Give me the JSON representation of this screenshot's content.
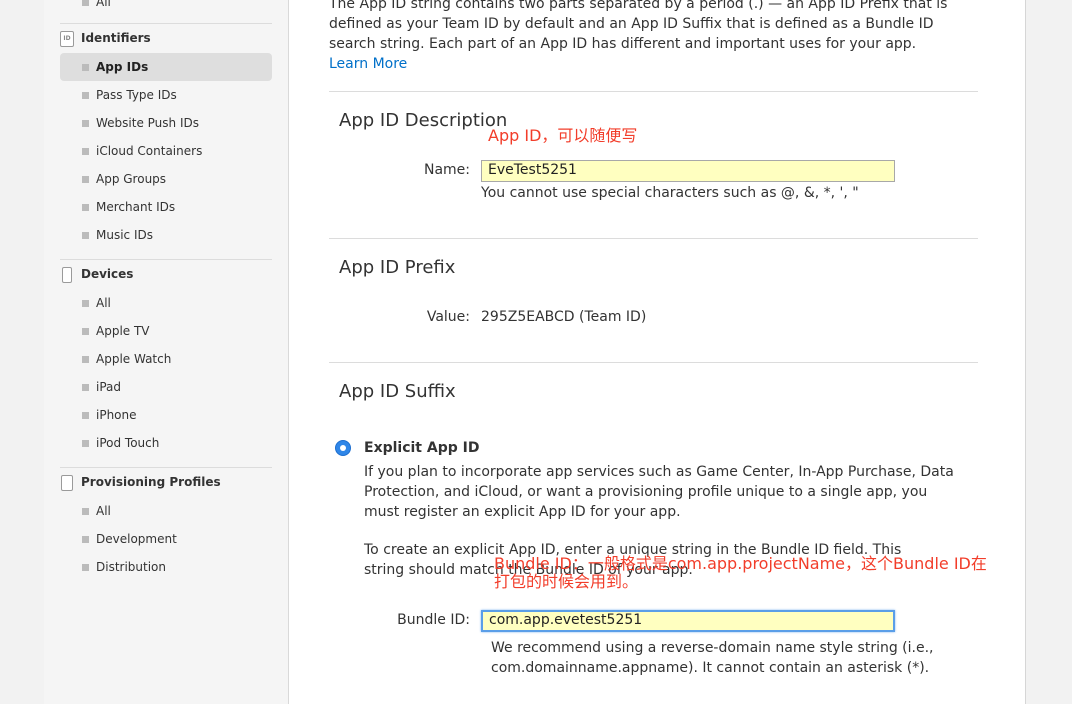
{
  "sidebar": {
    "top_item": "All",
    "identifiers": {
      "header": "Identifiers",
      "icon_text": "ID",
      "items": [
        "App IDs",
        "Pass Type IDs",
        "Website Push IDs",
        "iCloud Containers",
        "App Groups",
        "Merchant IDs",
        "Music IDs"
      ]
    },
    "devices": {
      "header": "Devices",
      "items": [
        "All",
        "Apple TV",
        "Apple Watch",
        "iPad",
        "iPhone",
        "iPod Touch"
      ]
    },
    "profiles": {
      "header": "Provisioning Profiles",
      "items": [
        "All",
        "Development",
        "Distribution"
      ]
    }
  },
  "intro": {
    "text": "The App ID string contains two parts separated by a period (.) — an App ID Prefix that is defined as your Team ID by default and an App ID Suffix that is defined as a Bundle ID search string. Each part of an App ID has different and important uses for your app.",
    "link": "Learn More"
  },
  "description": {
    "title": "App ID Description",
    "annotation": "App ID，可以随便写",
    "name_label": "Name:",
    "name_value": "EveTest5251",
    "hint": "You cannot use special characters such as @, &, *, ', \""
  },
  "prefix": {
    "title": "App ID Prefix",
    "value_label": "Value:",
    "value": "295Z5EABCD (Team ID)"
  },
  "suffix": {
    "title": "App ID Suffix",
    "explicit_label": "Explicit App ID",
    "explicit_desc": "If you plan to incorporate app services such as Game Center, In-App Purchase, Data Protection, and iCloud, or want a provisioning profile unique to a single app, you must register an explicit App ID for your app.",
    "create_desc": "To create an explicit App ID, enter a unique string in the Bundle ID field. This string should match the Bundle ID of your app.",
    "annotation": "Bundle ID：一般格式是com.app.projectName，这个Bundle ID在打包的时候会用到。",
    "bundle_label": "Bundle ID:",
    "bundle_value": "com.app.evetest5251",
    "bundle_hint": "We recommend using a reverse-domain name style string (i.e., com.domainname.appname). It cannot contain an asterisk (*)."
  },
  "colors": {
    "accent": "#0070c9",
    "annotation": "#f23d2a",
    "field_bg": "#ffffc0",
    "radio": "#2f86e8"
  }
}
